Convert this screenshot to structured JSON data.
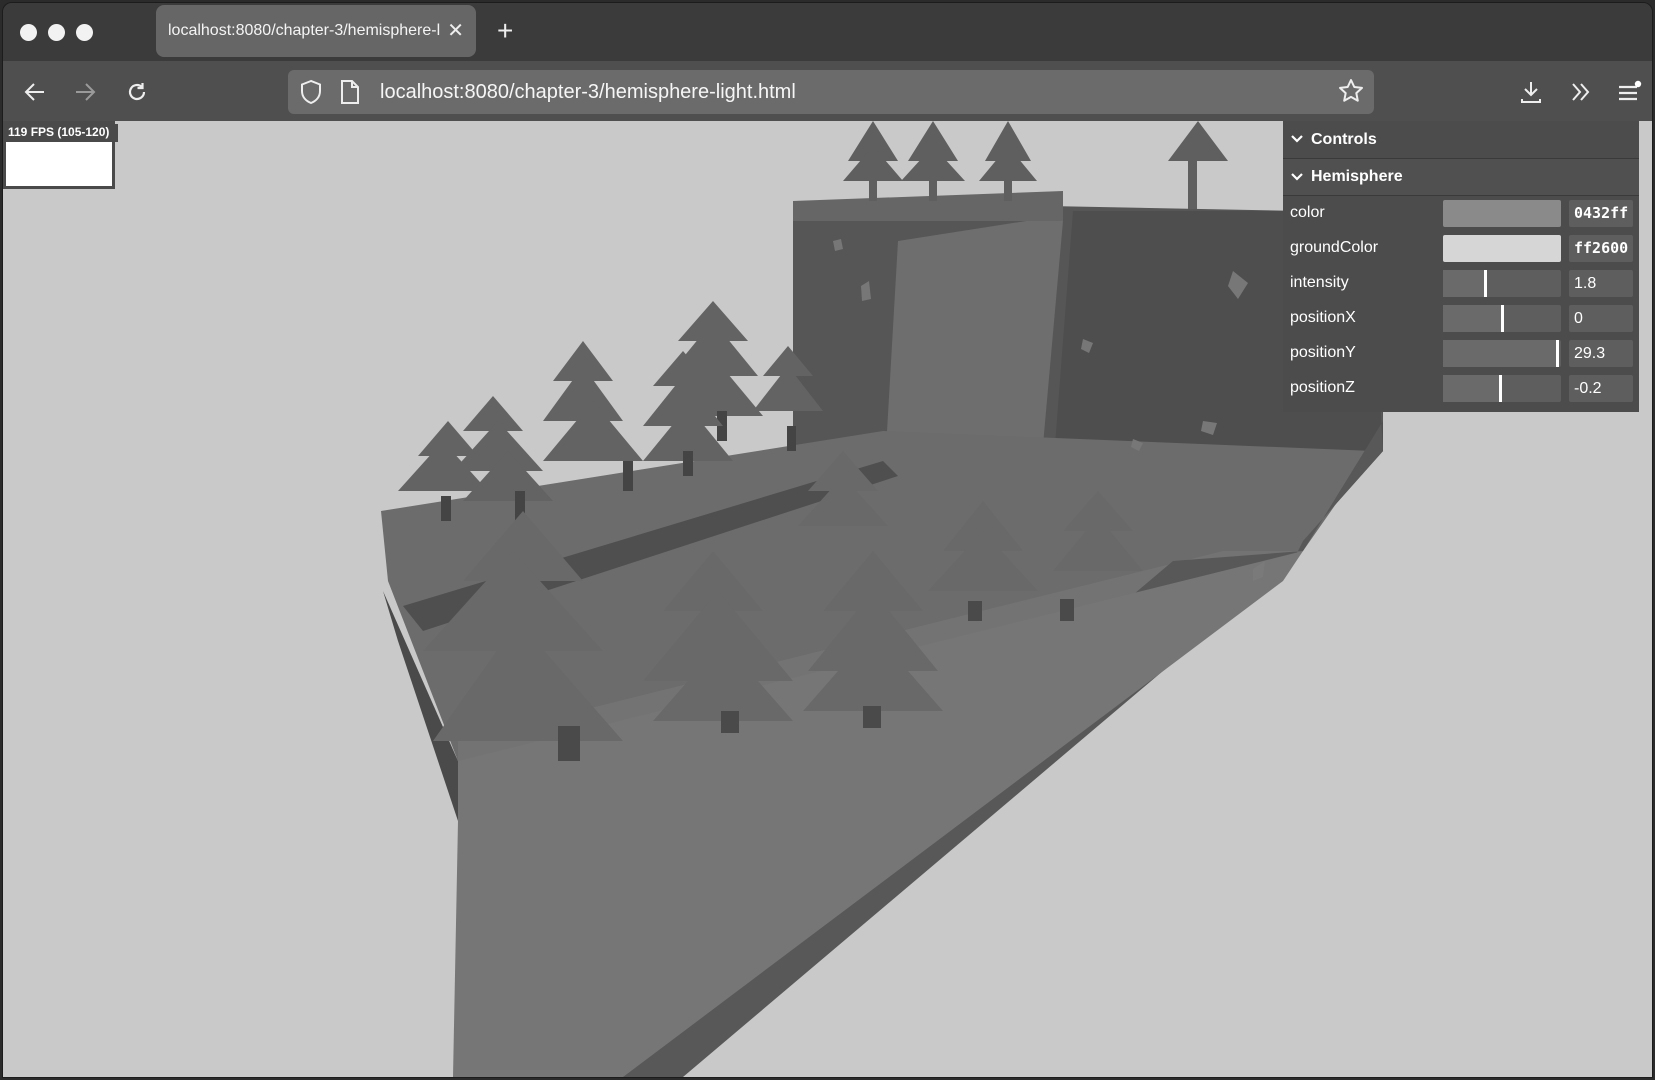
{
  "browser": {
    "tab_title": "localhost:8080/chapter-3/hemisphere-light.html",
    "tab_close_icon": "close-icon",
    "new_tab_symbol": "+",
    "url": "localhost:8080/chapter-3/hemisphere-light.html"
  },
  "stats": {
    "fps_label": "119 FPS (105-120)"
  },
  "controls": {
    "title": "Controls",
    "folder": "Hemisphere",
    "rows": [
      {
        "label": "color",
        "value": "0432ff",
        "swatch": "#8a8a8a"
      },
      {
        "label": "groundColor",
        "value": "ff2600",
        "swatch": "#d6d6d6"
      },
      {
        "label": "intensity",
        "value": "1.8",
        "level": 0.36
      },
      {
        "label": "positionX",
        "value": "0",
        "level": 0.5
      },
      {
        "label": "positionY",
        "value": "29.3",
        "level": 0.98
      },
      {
        "label": "positionZ",
        "value": "-0.2",
        "level": 0.49
      }
    ]
  },
  "colors": {
    "background": "#c9c9c9",
    "panel": "#4c4c4c",
    "urlbar": "#6b6b6b"
  }
}
